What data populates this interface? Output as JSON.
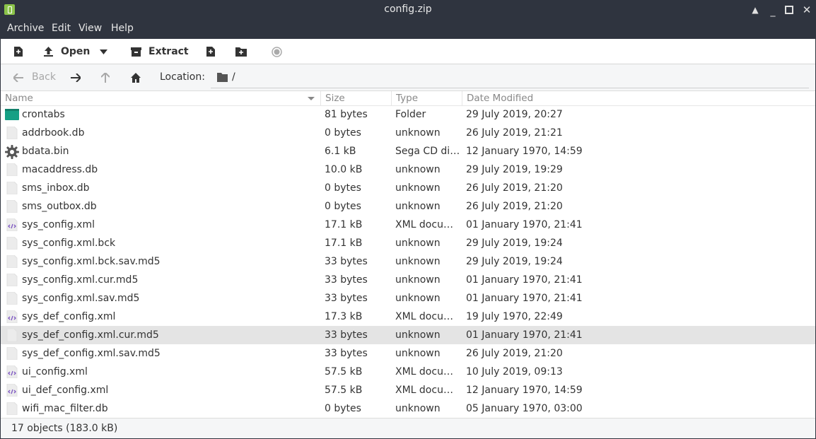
{
  "window": {
    "title": "config.zip"
  },
  "menu": [
    "Archive",
    "Edit",
    "View",
    "Help"
  ],
  "toolbar": {
    "open_label": "Open",
    "extract_label": "Extract"
  },
  "location": {
    "back_label": "Back",
    "label": "Location:",
    "path": "/"
  },
  "columns": {
    "name": "Name",
    "size": "Size",
    "type": "Type",
    "modified": "Date Modified"
  },
  "files": [
    {
      "name": "crontabs",
      "size": "81 bytes",
      "type": "Folder",
      "modified": "29 July 2019, 20:27",
      "icon": "folder-icon"
    },
    {
      "name": "addrbook.db",
      "size": "0 bytes",
      "type": "unknown",
      "modified": "26 July 2019, 21:21",
      "icon": "file-icon"
    },
    {
      "name": "bdata.bin",
      "size": "6.1 kB",
      "type": "Sega CD disc …",
      "modified": "12 January 1970, 14:59",
      "icon": "gear-icon"
    },
    {
      "name": "macaddress.db",
      "size": "10.0 kB",
      "type": "unknown",
      "modified": "29 July 2019, 19:29",
      "icon": "file-icon"
    },
    {
      "name": "sms_inbox.db",
      "size": "0 bytes",
      "type": "unknown",
      "modified": "26 July 2019, 21:20",
      "icon": "file-icon"
    },
    {
      "name": "sms_outbox.db",
      "size": "0 bytes",
      "type": "unknown",
      "modified": "26 July 2019, 21:20",
      "icon": "file-icon"
    },
    {
      "name": "sys_config.xml",
      "size": "17.1 kB",
      "type": "XML docume…",
      "modified": "01 January 1970, 21:41",
      "icon": "xml-file-icon"
    },
    {
      "name": "sys_config.xml.bck",
      "size": "17.1 kB",
      "type": "unknown",
      "modified": "29 July 2019, 19:24",
      "icon": "file-icon"
    },
    {
      "name": "sys_config.xml.bck.sav.md5",
      "size": "33 bytes",
      "type": "unknown",
      "modified": "29 July 2019, 19:24",
      "icon": "file-icon"
    },
    {
      "name": "sys_config.xml.cur.md5",
      "size": "33 bytes",
      "type": "unknown",
      "modified": "01 January 1970, 21:41",
      "icon": "file-icon"
    },
    {
      "name": "sys_config.xml.sav.md5",
      "size": "33 bytes",
      "type": "unknown",
      "modified": "01 January 1970, 21:41",
      "icon": "file-icon"
    },
    {
      "name": "sys_def_config.xml",
      "size": "17.3 kB",
      "type": "XML docume…",
      "modified": "19 July 1970, 22:49",
      "icon": "xml-file-icon"
    },
    {
      "name": "sys_def_config.xml.cur.md5",
      "size": "33 bytes",
      "type": "unknown",
      "modified": "01 January 1970, 21:41",
      "icon": "file-icon",
      "selected": true
    },
    {
      "name": "sys_def_config.xml.sav.md5",
      "size": "33 bytes",
      "type": "unknown",
      "modified": "26 July 2019, 21:20",
      "icon": "file-icon"
    },
    {
      "name": "ui_config.xml",
      "size": "57.5 kB",
      "type": "XML docume…",
      "modified": "10 July 2019, 09:13",
      "icon": "xml-file-icon"
    },
    {
      "name": "ui_def_config.xml",
      "size": "57.5 kB",
      "type": "XML docume…",
      "modified": "12 January 1970, 14:59",
      "icon": "xml-file-icon"
    },
    {
      "name": "wifi_mac_filter.db",
      "size": "0 bytes",
      "type": "unknown",
      "modified": "05 January 1970, 03:00",
      "icon": "file-icon"
    }
  ],
  "status": {
    "text": "17 objects (183.0 kB)"
  },
  "colors": {
    "titlebar": "#2f343f",
    "folder": "#16a085",
    "xml": "#7e57c2",
    "selected_row": "#e4e4e4"
  }
}
